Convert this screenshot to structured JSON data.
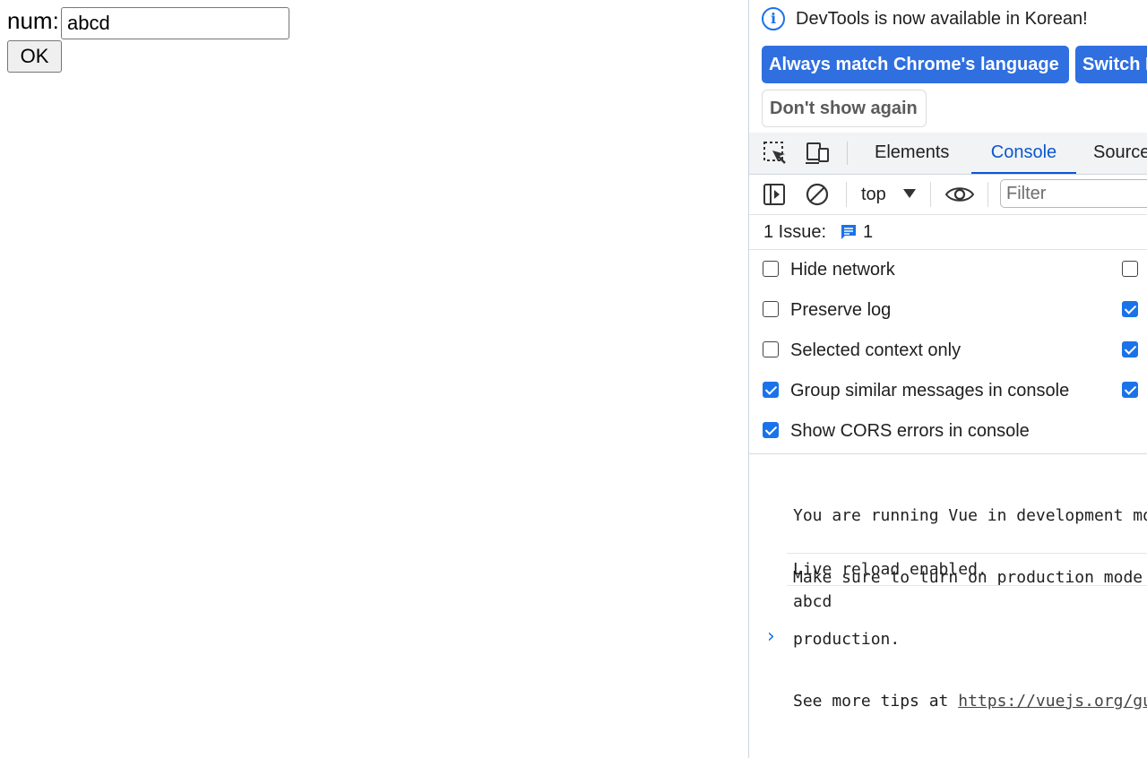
{
  "page": {
    "num_label": "num:",
    "num_value": "abcd",
    "ok_label": "OK"
  },
  "devtools": {
    "infobar": {
      "icon": "info-icon",
      "message": "DevTools is now available in Korean!",
      "always_match_label": "Always match Chrome's language",
      "switch_label": "Switch DevTools to Korean",
      "dont_show_label": "Don't show again"
    },
    "tabs": {
      "inspect_icon": "inspect-element-icon",
      "device_icon": "device-toolbar-icon",
      "elements": "Elements",
      "console": "Console",
      "sources": "Sources"
    },
    "toolbar": {
      "sidebar_icon": "sidebar-toggle-icon",
      "clear_icon": "clear-console-icon",
      "context": "top",
      "eye_icon": "live-expression-eye-icon",
      "filter_placeholder": "Filter"
    },
    "issues": {
      "label": "1 Issue:",
      "icon": "issue-message-icon",
      "count": "1"
    },
    "settings": [
      {
        "label": "Hide network",
        "checked": false,
        "right_checked": false
      },
      {
        "label": "Preserve log",
        "checked": false,
        "right_checked": true
      },
      {
        "label": "Selected context only",
        "checked": false,
        "right_checked": true
      },
      {
        "label": "Group similar messages in console",
        "checked": true,
        "right_checked": true
      },
      {
        "label": "Show CORS errors in console",
        "checked": true,
        "right_checked": null
      }
    ],
    "messages": {
      "vue_line1": "You are running Vue in development mode.",
      "vue_line2": "Make sure to turn on production mode when deploying for",
      "vue_line3": "production.",
      "vue_line4_prefix": "See more tips at ",
      "vue_link": "https://vuejs.org/guide/deployment.html",
      "live_reload": "Live reload enabled.",
      "log_value": "abcd",
      "prompt": "›"
    },
    "colors": {
      "accent": "#1a73e8",
      "button_blue": "#2f6fe0"
    }
  }
}
